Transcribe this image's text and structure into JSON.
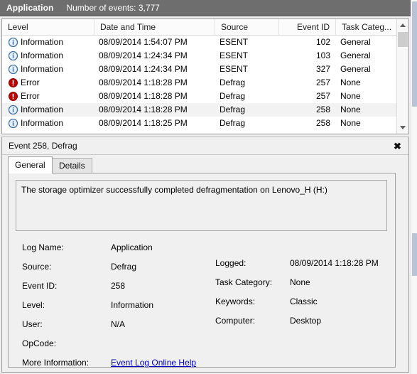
{
  "log_header": {
    "log_name": "Application",
    "event_count_label": "Number of events: 3,777"
  },
  "event_list": {
    "columns": [
      {
        "label": "Level",
        "align": "left"
      },
      {
        "label": "Date and Time",
        "align": "left"
      },
      {
        "label": "Source",
        "align": "left"
      },
      {
        "label": "Event ID",
        "align": "right"
      },
      {
        "label": "Task Categ...",
        "align": "left"
      }
    ],
    "rows": [
      {
        "icon": "information-icon",
        "level": "Information",
        "datetime": "08/09/2014 1:54:07 PM",
        "source": "ESENT",
        "event_id": "102",
        "task_category": "General",
        "selected": false
      },
      {
        "icon": "information-icon",
        "level": "Information",
        "datetime": "08/09/2014 1:24:34 PM",
        "source": "ESENT",
        "event_id": "103",
        "task_category": "General",
        "selected": false
      },
      {
        "icon": "information-icon",
        "level": "Information",
        "datetime": "08/09/2014 1:24:34 PM",
        "source": "ESENT",
        "event_id": "327",
        "task_category": "General",
        "selected": false
      },
      {
        "icon": "error-icon",
        "level": "Error",
        "datetime": "08/09/2014 1:18:28 PM",
        "source": "Defrag",
        "event_id": "257",
        "task_category": "None",
        "selected": false
      },
      {
        "icon": "error-icon",
        "level": "Error",
        "datetime": "08/09/2014 1:18:28 PM",
        "source": "Defrag",
        "event_id": "257",
        "task_category": "None",
        "selected": false
      },
      {
        "icon": "information-icon",
        "level": "Information",
        "datetime": "08/09/2014 1:18:28 PM",
        "source": "Defrag",
        "event_id": "258",
        "task_category": "None",
        "selected": true
      },
      {
        "icon": "information-icon",
        "level": "Information",
        "datetime": "08/09/2014 1:18:25 PM",
        "source": "Defrag",
        "event_id": "258",
        "task_category": "None",
        "selected": false
      }
    ]
  },
  "detail": {
    "title": "Event 258, Defrag",
    "close_label": "✖",
    "tabs": [
      {
        "label": "General",
        "active": true
      },
      {
        "label": "Details",
        "active": false
      }
    ],
    "message": "The storage optimizer successfully completed defragmentation on Lenovo_H (H:)",
    "properties_left": [
      {
        "label": "Log Name:",
        "value": "Application"
      },
      {
        "label": "Source:",
        "value": "Defrag"
      },
      {
        "label": "Event ID:",
        "value": "258"
      },
      {
        "label": "Level:",
        "value": "Information"
      },
      {
        "label": "User:",
        "value": "N/A"
      },
      {
        "label": "OpCode:",
        "value": ""
      },
      {
        "label": "More Information:",
        "value": "Event Log Online Help",
        "is_link": true
      }
    ],
    "properties_right": [
      {
        "label": "Logged:",
        "value": "08/09/2014 1:18:28 PM"
      },
      {
        "label": "Task Category:",
        "value": "None"
      },
      {
        "label": "Keywords:",
        "value": "Classic"
      },
      {
        "label": "Computer:",
        "value": "Desktop"
      }
    ]
  },
  "colors": {
    "header_bar": "#6e6e6e",
    "selection": "#f2f2f2",
    "error_icon": "#c00000",
    "info_icon": "#3b6fa8",
    "link": "#0000c0"
  }
}
